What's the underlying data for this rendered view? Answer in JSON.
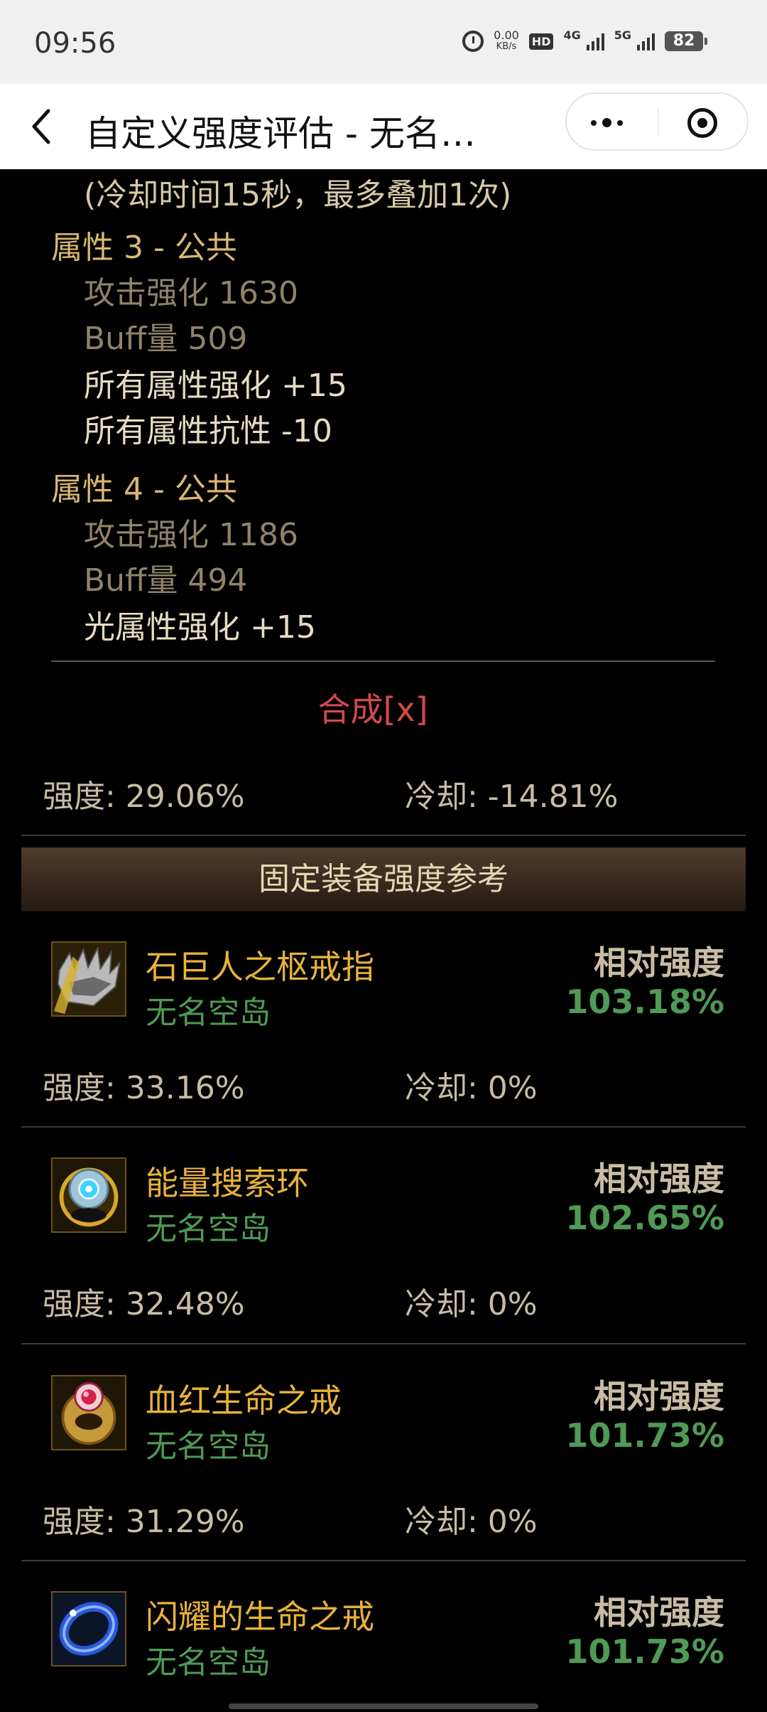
{
  "status_bar": {
    "time": "09:56",
    "speed_value": "0.00",
    "speed_unit": "KB/s",
    "hd_label": "HD",
    "sim1_label": "4G",
    "sim2_label": "5G",
    "battery": "82"
  },
  "navbar": {
    "title": "自定义强度评估 - 无名…"
  },
  "content": {
    "cooldown_note": "(冷却时间15秒，最多叠加1次)",
    "attribute_groups": [
      {
        "title": "属性 3 - 公共",
        "lines": [
          {
            "text": "攻击强化   1630",
            "style": "dim"
          },
          {
            "text": "Buff量   509",
            "style": "dim"
          },
          {
            "text": "所有属性强化 +15",
            "style": "bright"
          },
          {
            "text": "所有属性抗性 -10",
            "style": "bright"
          }
        ]
      },
      {
        "title": "属性 4 - 公共",
        "lines": [
          {
            "text": "攻击强化   1186",
            "style": "dim"
          },
          {
            "text": "Buff量   494",
            "style": "dim"
          },
          {
            "text": "光属性强化 +15",
            "style": "bright"
          }
        ]
      }
    ],
    "synth_link": "合成[x]",
    "summary": {
      "strength": "强度: 29.06%",
      "cooldown": "冷却: -14.81%"
    },
    "section_title": "固定装备强度参考",
    "items": [
      {
        "name": "石巨人之枢戒指",
        "source": "无名空岛",
        "rel_label": "相对强度",
        "rel_value": "103.18%",
        "strength": "强度: 33.16%",
        "cooldown": "冷却: 0%",
        "icon": "spiked-ring-icon"
      },
      {
        "name": "能量搜索环",
        "source": "无名空岛",
        "rel_label": "相对强度",
        "rel_value": "102.65%",
        "strength": "强度: 32.48%",
        "cooldown": "冷却: 0%",
        "icon": "energy-ring-icon"
      },
      {
        "name": "血红生命之戒",
        "source": "无名空岛",
        "rel_label": "相对强度",
        "rel_value": "101.73%",
        "strength": "强度: 31.29%",
        "cooldown": "冷却: 0%",
        "icon": "crimson-ring-icon"
      },
      {
        "name": "闪耀的生命之戒",
        "source": "无名空岛",
        "rel_label": "相对强度",
        "rel_value": "101.73%",
        "icon": "shining-ring-icon"
      }
    ]
  }
}
